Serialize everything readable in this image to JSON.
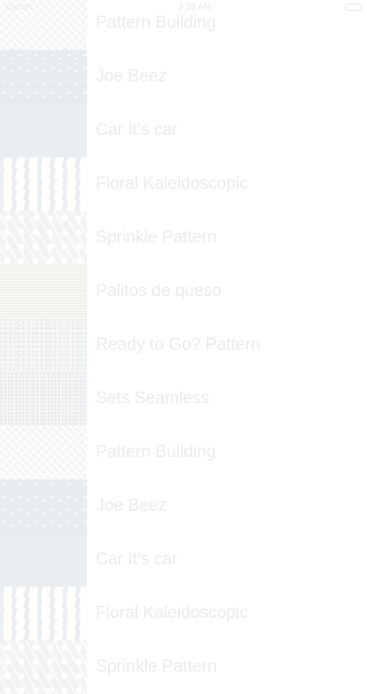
{
  "status_bar": {
    "carrier": "Carrier",
    "time": "3:38 AM"
  },
  "patterns": [
    {
      "title": "Pattern Building",
      "thumb": "p-building"
    },
    {
      "title": "Joe Beez",
      "thumb": "p-joe"
    },
    {
      "title": "Car It's car",
      "thumb": "p-car"
    },
    {
      "title": "Floral Kaleidoscopic",
      "thumb": "p-floral"
    },
    {
      "title": "Sprinkle Pattern",
      "thumb": "p-sprinkle"
    },
    {
      "title": "Palitos de queso",
      "thumb": "p-palitos"
    },
    {
      "title": "Ready to Go? Pattern",
      "thumb": "p-ready"
    },
    {
      "title": "Sets Seamless",
      "thumb": "p-sets"
    },
    {
      "title": "Pattern Building",
      "thumb": "p-building"
    },
    {
      "title": "Joe Beez",
      "thumb": "p-joe"
    },
    {
      "title": "Car It's car",
      "thumb": "p-car"
    },
    {
      "title": "Floral Kaleidoscopic",
      "thumb": "p-floral"
    },
    {
      "title": "Sprinkle Pattern",
      "thumb": "p-sprinkle"
    }
  ]
}
